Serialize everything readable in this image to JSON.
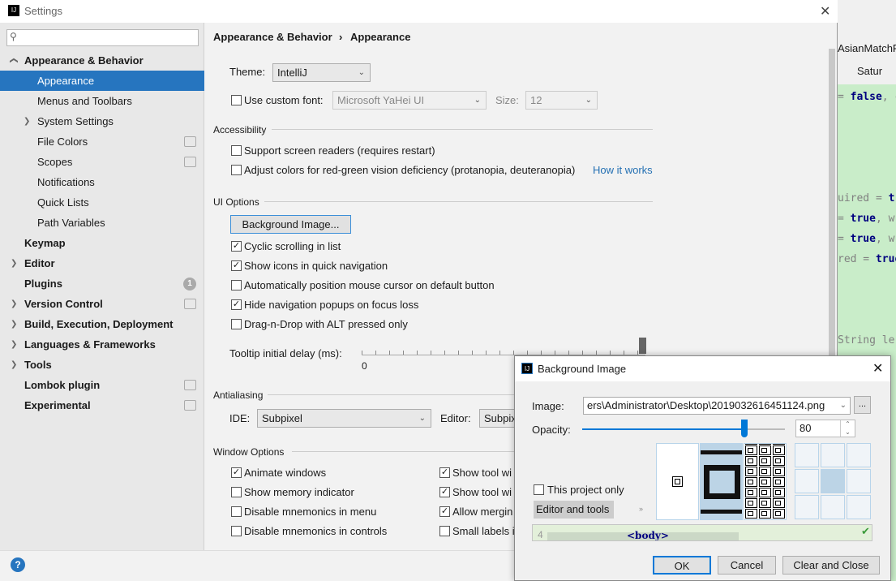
{
  "window": {
    "title": "Settings",
    "close": "✕"
  },
  "ide": {
    "tab1": "AsianMatchR",
    "tab2": "Satur",
    "lines": [
      {
        "pre": " = ",
        "kw": "false",
        "post": ", c"
      },
      {
        "pre": "uired = ",
        "kw": "tr",
        "post": ""
      },
      {
        "pre": " = ",
        "kw": "true",
        "post": ",  w"
      },
      {
        "pre": " = ",
        "kw": "true",
        "post": ",  w"
      },
      {
        "pre": "red = ",
        "kw": "true",
        "post": ""
      },
      {
        "pre": " String le",
        "kw": "",
        "post": ""
      }
    ]
  },
  "sidebar": {
    "search_placeholder": "",
    "items": [
      {
        "label": "Appearance & Behavior",
        "bold": true,
        "arrow": "∨"
      },
      {
        "label": "Appearance",
        "selected": true
      },
      {
        "label": "Menus and Toolbars"
      },
      {
        "label": "System Settings",
        "arrow": ">"
      },
      {
        "label": "File Colors",
        "badge": true
      },
      {
        "label": "Scopes",
        "badge": true
      },
      {
        "label": "Notifications"
      },
      {
        "label": "Quick Lists"
      },
      {
        "label": "Path Variables"
      },
      {
        "label": "Keymap",
        "bold": true
      },
      {
        "label": "Editor",
        "bold": true,
        "arrow": ">"
      },
      {
        "label": "Plugins",
        "bold": true,
        "count": "1"
      },
      {
        "label": "Version Control",
        "bold": true,
        "arrow": ">",
        "badge": true
      },
      {
        "label": "Build, Execution, Deployment",
        "bold": true,
        "arrow": ">"
      },
      {
        "label": "Languages & Frameworks",
        "bold": true,
        "arrow": ">"
      },
      {
        "label": "Tools",
        "bold": true,
        "arrow": ">"
      },
      {
        "label": "Lombok plugin",
        "bold": true,
        "badge": true
      },
      {
        "label": "Experimental",
        "bold": true,
        "badge": true
      }
    ]
  },
  "breadcrumb": {
    "parent": "Appearance & Behavior",
    "sep": "›",
    "current": "Appearance"
  },
  "theme": {
    "label": "Theme:",
    "value": "IntelliJ"
  },
  "font": {
    "label": "Use custom font:",
    "value": "Microsoft YaHei UI",
    "size_label": "Size:",
    "size_value": "12"
  },
  "accessibility": {
    "title": "Accessibility",
    "screen_readers": "Support screen readers (requires restart)",
    "colors": "Adjust colors for red-green vision deficiency (protanopia, deuteranopia)",
    "how_link": "How it works"
  },
  "ui_options": {
    "title": "UI Options",
    "bg_button": "Background Image...",
    "items": [
      {
        "label": "Cyclic scrolling in list",
        "checked": true
      },
      {
        "label": "Show icons in quick navigation",
        "checked": true
      },
      {
        "label": "Automatically position mouse cursor on default button",
        "checked": false
      },
      {
        "label": "Hide navigation popups on focus loss",
        "checked": true
      },
      {
        "label": "Drag-n-Drop with ALT pressed only",
        "checked": false
      }
    ],
    "tooltip_label": "Tooltip initial delay (ms):",
    "tooltip_min": "0",
    "tooltip_value_fraction": 1.0
  },
  "antialiasing": {
    "title": "Antialiasing",
    "ide_label": "IDE:",
    "ide_value": "Subpixel",
    "editor_label": "Editor:",
    "editor_value": "Subpix"
  },
  "window_options": {
    "title": "Window Options",
    "left": [
      {
        "label": "Animate windows",
        "checked": true
      },
      {
        "label": "Show memory indicator",
        "checked": false
      },
      {
        "label": "Disable mnemonics in menu",
        "checked": false
      },
      {
        "label": "Disable mnemonics in controls",
        "checked": false
      }
    ],
    "right": [
      {
        "label": "Show tool wi",
        "checked": true
      },
      {
        "label": "Show tool wi",
        "checked": true
      },
      {
        "label": "Allow mergin",
        "checked": true
      },
      {
        "label": "Small labels i",
        "checked": false
      }
    ]
  },
  "help": "?",
  "dialog": {
    "title": "Background Image",
    "close": "✕",
    "image_label": "Image:",
    "image_value": "ers\\Administrator\\Desktop\\2019032616451124.png",
    "browse": "...",
    "opacity_label": "Opacity:",
    "opacity_value": "80",
    "opacity_max": "100",
    "project_only": "This project only",
    "target": "Editor and tools",
    "more": "»",
    "preview_line": "4",
    "preview_tag": "<body>",
    "ok": "OK",
    "cancel": "Cancel",
    "clear": "Clear and Close",
    "accent": "#0078d7"
  }
}
